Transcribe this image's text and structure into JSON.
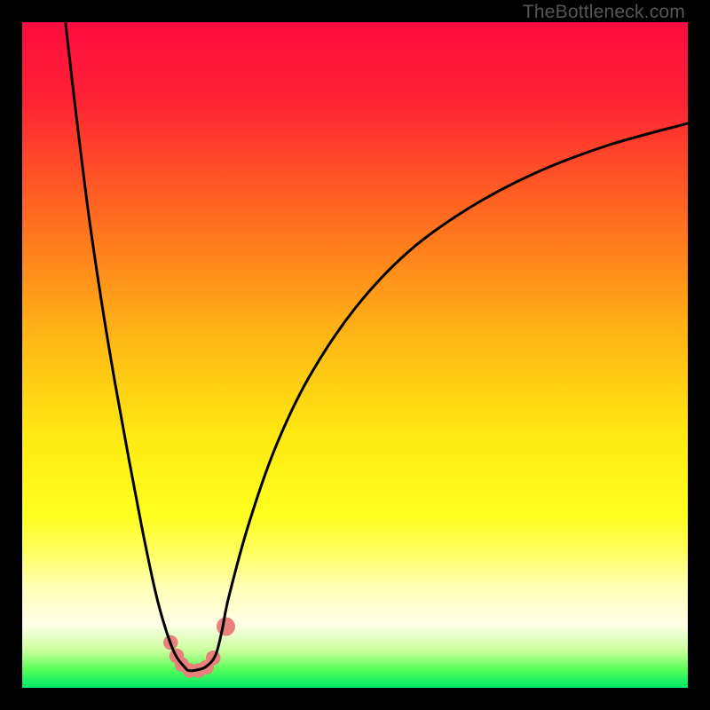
{
  "watermark": "TheBottleneck.com",
  "chart_data": {
    "type": "line",
    "title": "",
    "xlabel": "",
    "ylabel": "",
    "xlim": [
      0,
      100
    ],
    "ylim": [
      0,
      100
    ],
    "gradient_stops": [
      {
        "pos": 0.0,
        "color": "#ff0b40"
      },
      {
        "pos": 0.12,
        "color": "#ff2433"
      },
      {
        "pos": 0.3,
        "color": "#ff6f1f"
      },
      {
        "pos": 0.48,
        "color": "#ffb915"
      },
      {
        "pos": 0.62,
        "color": "#ffe913"
      },
      {
        "pos": 0.74,
        "color": "#ffff1f"
      },
      {
        "pos": 0.8,
        "color": "#ffff66"
      },
      {
        "pos": 0.85,
        "color": "#ffffb8"
      },
      {
        "pos": 0.905,
        "color": "#ffffe8"
      },
      {
        "pos": 0.945,
        "color": "#c8ff9a"
      },
      {
        "pos": 0.972,
        "color": "#58ff58"
      },
      {
        "pos": 1.0,
        "color": "#00e868"
      }
    ],
    "series": [
      {
        "name": "bottleneck-curve",
        "x": [
          6.5,
          8.0,
          10.0,
          12.0,
          14.0,
          16.0,
          18.0,
          20.0,
          21.5,
          23.0,
          24.5,
          25.0,
          25.8,
          27.5,
          29.0,
          30.0,
          31.0,
          34.0,
          38.0,
          43.0,
          50.0,
          58.0,
          67.0,
          77.0,
          88.0,
          100.0
        ],
        "values": [
          100.0,
          87.0,
          71.0,
          57.5,
          45.5,
          34.5,
          24.0,
          14.5,
          9.0,
          5.0,
          3.0,
          2.6,
          2.6,
          3.1,
          4.8,
          8.5,
          13.5,
          24.5,
          36.0,
          46.5,
          57.0,
          65.5,
          72.0,
          77.3,
          81.5,
          84.8
        ]
      }
    ],
    "markers": {
      "name": "highlight-points",
      "color": "#e8817c",
      "points": [
        {
          "x": 22.3,
          "y": 6.8,
          "r": 1.1
        },
        {
          "x": 23.2,
          "y": 4.8,
          "r": 1.1
        },
        {
          "x": 24.0,
          "y": 3.5,
          "r": 1.1
        },
        {
          "x": 25.2,
          "y": 2.6,
          "r": 1.1
        },
        {
          "x": 26.5,
          "y": 2.6,
          "r": 1.1
        },
        {
          "x": 27.7,
          "y": 3.1,
          "r": 1.1
        },
        {
          "x": 28.7,
          "y": 4.5,
          "r": 1.1
        },
        {
          "x": 30.6,
          "y": 9.2,
          "r": 1.4
        }
      ]
    }
  }
}
